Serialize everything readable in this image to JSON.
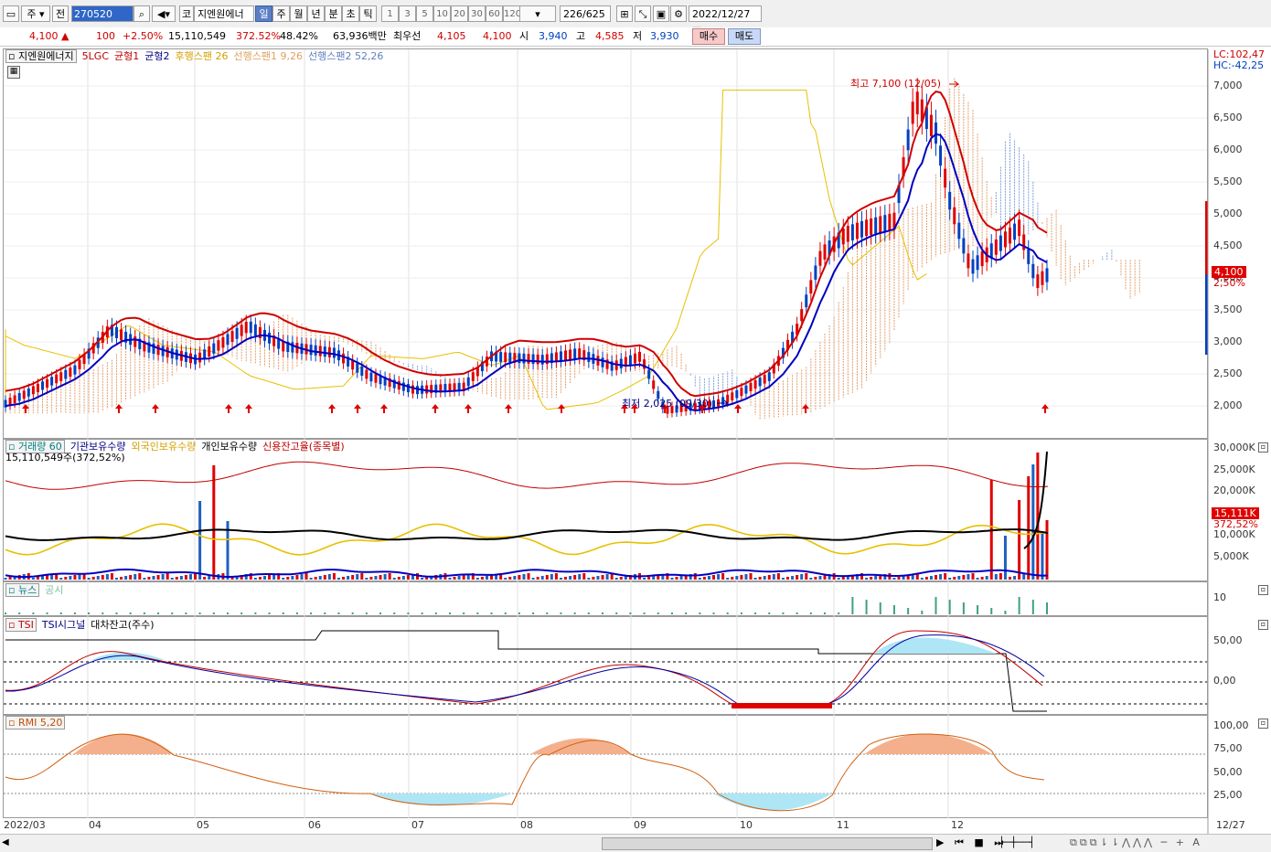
{
  "toolbar": {
    "market_btn": "주",
    "prev_btn": "전",
    "code": "270520",
    "stock_btn": "코",
    "stock_name": "지엔원에너",
    "periods": [
      "일",
      "주",
      "월",
      "년",
      "분",
      "초",
      "틱"
    ],
    "minutes": [
      "1",
      "3",
      "5",
      "10",
      "20",
      "30",
      "60",
      "120"
    ],
    "count": "226",
    "count_total": "/625",
    "date": "2022/12/27"
  },
  "quote": {
    "price": "4,100 ▲",
    "change": "100",
    "change_pct": "+2.50%",
    "volume": "15,110,549",
    "volume_ratio": "372.52%",
    "turnover_ratio": "48.42%",
    "amount": "63,936백만",
    "best_ask_label": "최우선",
    "best_ask": "4,105",
    "best_bid": "4,100",
    "open_label": "시",
    "open": "3,940",
    "high_label": "고",
    "high": "4,585",
    "low_label": "저",
    "low": "3,930",
    "buy": "매수",
    "sell": "매도"
  },
  "price_pane": {
    "legend": [
      {
        "text": "지엔원에너지",
        "color": "#000000"
      },
      {
        "text": "5LGC",
        "color": "#c00000"
      },
      {
        "text": "균형1",
        "color": "#c00000"
      },
      {
        "text": "균형2",
        "color": "#000080"
      },
      {
        "text": "후행스팬 26",
        "color": "#d4a000"
      },
      {
        "text": "선행스팬1 9,26",
        "color": "#e0a060"
      },
      {
        "text": "선행스팬2 52,26",
        "color": "#6080c0"
      }
    ],
    "lc": "LC:102,47",
    "hc": "HC:-42,25",
    "y_ticks": [
      "7,000",
      "6,500",
      "6,000",
      "5,500",
      "5,000",
      "4,500",
      "4,000",
      "3,500",
      "3,000",
      "2,500",
      "2,000"
    ],
    "price_tag": "4,100",
    "pct_tag": "2,50%",
    "annotation_high": "최고 7,100 (12/05)",
    "annotation_low": "최저 2,025 (09/30)"
  },
  "volume_pane": {
    "legend": [
      {
        "text": "거래량 60",
        "color": "#008080"
      },
      {
        "text": "기관보유수량",
        "color": "#000080"
      },
      {
        "text": "외국인보유수량",
        "color": "#d4a000"
      },
      {
        "text": "개인보유수량",
        "color": "#000000"
      },
      {
        "text": "신용잔고율(종목별)",
        "color": "#c00000"
      }
    ],
    "sub": "15,110,549주(372,52%)",
    "y_ticks": [
      "30,000K",
      "25,000K",
      "20,000K",
      "15,000K",
      "10,000K",
      "5,000K"
    ],
    "vol_tag": "15,111K",
    "ratio_tag": "372,52%"
  },
  "news_pane": {
    "legend": [
      {
        "text": "뉴스",
        "color": "#008080"
      },
      {
        "text": "공시",
        "color": "#80c0a0"
      }
    ],
    "y_tick": "10"
  },
  "tsi_pane": {
    "legend": [
      {
        "text": "TSI",
        "color": "#c00000"
      },
      {
        "text": "TSI시그널",
        "color": "#000080"
      },
      {
        "text": "대차잔고(주수)",
        "color": "#000000"
      }
    ],
    "y_ticks": [
      "50,00",
      "0,00"
    ]
  },
  "rmi_pane": {
    "legend": [
      {
        "text": "RMI 5,20",
        "color": "#c05000"
      }
    ],
    "y_ticks": [
      "100,00",
      "75,00",
      "50,00",
      "25,00"
    ]
  },
  "x_axis": [
    "2022/03",
    "04",
    "05",
    "06",
    "07",
    "08",
    "09",
    "10",
    "11",
    "12"
  ],
  "x_end": "12/27",
  "colors": {
    "up": "#e00000",
    "down": "#0040c0",
    "ma_red": "#d00000",
    "ma_blue": "#0000c0",
    "lag": "#e8c000",
    "toolbar_on": "#5b7ec4"
  }
}
